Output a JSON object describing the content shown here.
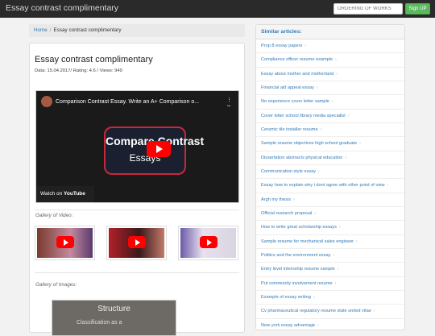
{
  "header": {
    "brand": "Essay contrast complimentary",
    "order_placeholder": "ORDERING OF WORKS",
    "signup_label": "Sign UP"
  },
  "breadcrumb": {
    "home": "Home",
    "separator": "/",
    "current": "Essay contrast complimentary"
  },
  "article": {
    "title": "Essay contrast complimentary",
    "meta": "Data: 15.04.2017/ Rating: 4.6 / Views: 949",
    "video": {
      "title": "Comparison Contrast Essay. Write an A+ Comparison o...",
      "thumb_line1": "Compare Contrast",
      "thumb_line2": "Essays",
      "watch_on": "Watch on",
      "watch_logo": "YouTube"
    },
    "gallery_video_label": "Gallery of Video:",
    "gallery_images_label": "Gallery of Images:",
    "image_preview": {
      "heading": "Structure",
      "text": "Classification as a"
    }
  },
  "sidebar": {
    "title": "Similar articles:",
    "items": [
      "Prop 8 essay papers",
      "Compliance officer resume example",
      "Essay about mother and motherland",
      "Financial aid appeal essay",
      "No experience cover letter sample",
      "Cover letter school library media specialist",
      "Ceramic tile installer resume",
      "Sample resume objectives high school graduate",
      "Dissertation abstracts physical education",
      "Communication style essay",
      "Essay how to explain why i dont agree with other point of view",
      "Argh my thesis",
      "Official research proposal",
      "How to write great scholarship essays",
      "Sample resume for mechanical sales engineer",
      "Politics and the environment essay",
      "Entry level internship resume sample",
      "Put community involvement resume",
      "Example of essay writing",
      "Cv pharmaceutical regulatory resume state united vitae",
      "New york essay advantage"
    ]
  },
  "colors": {
    "link": "#337ab7",
    "signup": "#5cb85c",
    "topbar": "#2a2a2a",
    "play": "#ff0000"
  }
}
